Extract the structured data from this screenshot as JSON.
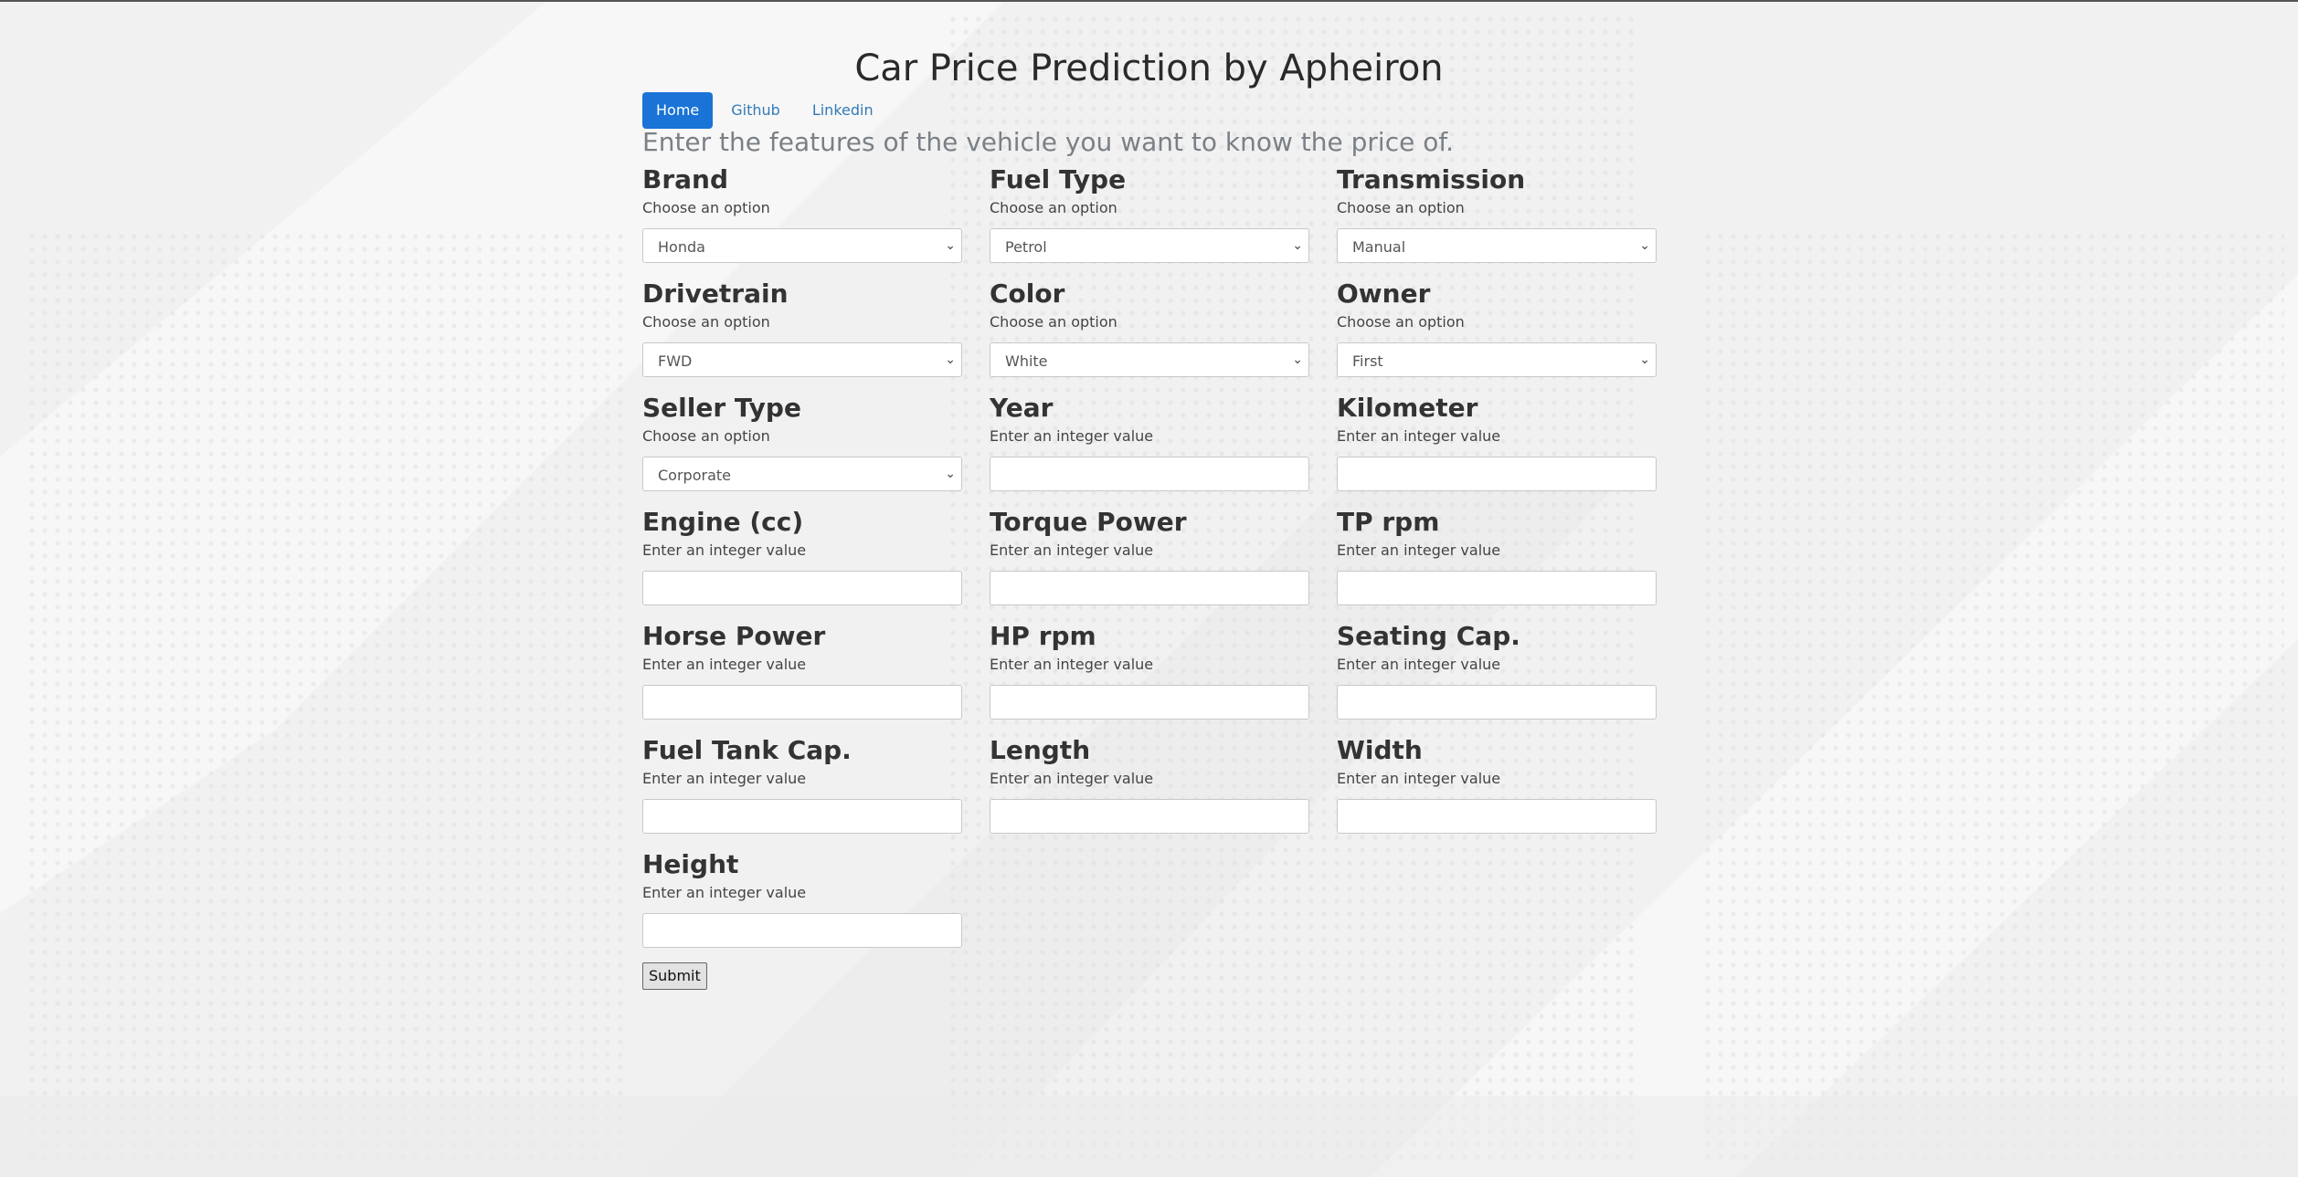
{
  "header": {
    "title": "Car Price Prediction by Apheiron",
    "subtitle": "Enter the features of the vehicle you want to know the price of."
  },
  "nav": {
    "items": [
      {
        "label": "Home"
      },
      {
        "label": "Github"
      },
      {
        "label": "Linkedin"
      }
    ]
  },
  "form": {
    "fields": [
      {
        "label": "Brand",
        "hint": "Choose an option",
        "value": "Honda"
      },
      {
        "label": "Fuel Type",
        "hint": "Choose an option",
        "value": "Petrol"
      },
      {
        "label": "Transmission",
        "hint": "Choose an option",
        "value": "Manual"
      },
      {
        "label": "Drivetrain",
        "hint": "Choose an option",
        "value": "FWD"
      },
      {
        "label": "Color",
        "hint": "Choose an option",
        "value": "White"
      },
      {
        "label": "Owner",
        "hint": "Choose an option",
        "value": "First"
      },
      {
        "label": "Seller Type",
        "hint": "Choose an option",
        "value": "Corporate"
      },
      {
        "label": "Year",
        "hint": "Enter an integer value",
        "value": ""
      },
      {
        "label": "Kilometer",
        "hint": "Enter an integer value",
        "value": ""
      },
      {
        "label": "Engine (cc)",
        "hint": "Enter an integer value",
        "value": ""
      },
      {
        "label": "Torque Power",
        "hint": "Enter an integer value",
        "value": ""
      },
      {
        "label": "TP rpm",
        "hint": "Enter an integer value",
        "value": ""
      },
      {
        "label": "Horse Power",
        "hint": "Enter an integer value",
        "value": ""
      },
      {
        "label": "HP rpm",
        "hint": "Enter an integer value",
        "value": ""
      },
      {
        "label": "Seating Cap.",
        "hint": "Enter an integer value",
        "value": ""
      },
      {
        "label": "Fuel Tank Cap.",
        "hint": "Enter an integer value",
        "value": ""
      },
      {
        "label": "Length",
        "hint": "Enter an integer value",
        "value": ""
      },
      {
        "label": "Width",
        "hint": "Enter an integer value",
        "value": ""
      },
      {
        "label": "Height",
        "hint": "Enter an integer value",
        "value": ""
      }
    ],
    "submit_label": "Submit"
  },
  "colors": {
    "accent": "#1a73d6",
    "link": "#337ab7",
    "background": "#f1f1f1"
  },
  "icons": {
    "select_arrow": "chevron-down-icon"
  }
}
